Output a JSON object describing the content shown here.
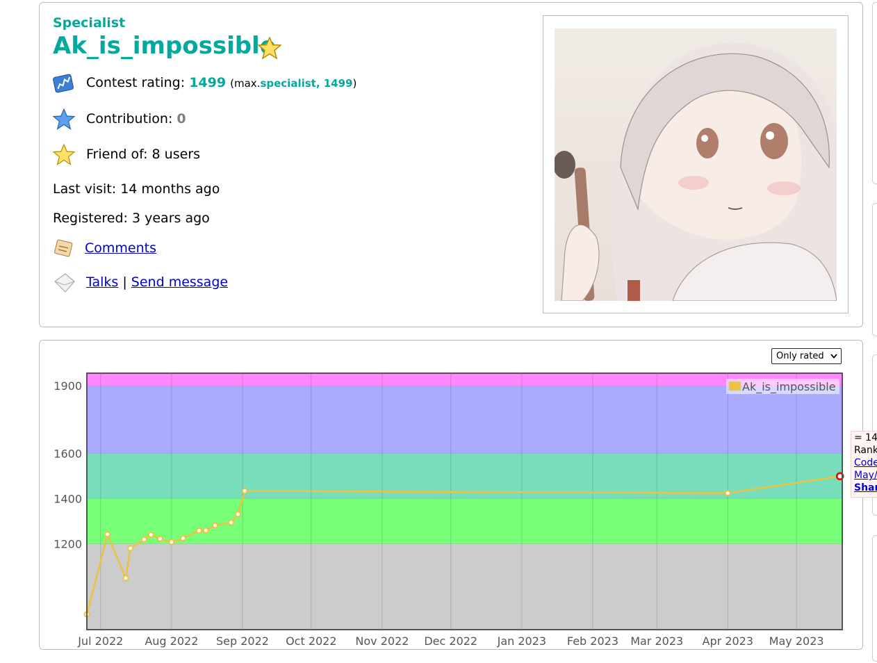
{
  "profile": {
    "rank": "Specialist",
    "handle": "Ak_is_impossible",
    "rating_label": "Contest rating:",
    "rating_value": "1499",
    "max_prefix": "(max.",
    "max_rank_rating": "specialist, 1499",
    "max_suffix": ")",
    "contribution_label": "Contribution:",
    "contribution_value": "0",
    "friend_label": "Friend of: 8 users",
    "last_visit": "Last visit: 14 months ago",
    "registered": "Registered: 3 years ago",
    "comments_link": "Comments",
    "talks_link": "Talks",
    "separator": "|",
    "send_message_link": "Send message"
  },
  "filter": {
    "selected": "Only rated"
  },
  "tooltip": {
    "line1": "= 14",
    "line2": "Rank",
    "line3": "Code",
    "line4": "May/",
    "line5": "Shar"
  },
  "colors": {
    "specialist": "#03a89e",
    "band_gray": "#cccccc",
    "band_green": "#77ff77",
    "band_cyan": "#77ddbb",
    "band_blue": "#aaaaff",
    "band_violet": "#ff88ff",
    "series": "#edc240"
  },
  "chart_data": {
    "type": "line",
    "legend": "Ak_is_impossible",
    "legend_position": "top-right",
    "ylim": [
      820,
      1955
    ],
    "y_ticks": [
      "1200",
      "1400",
      "1600",
      "1900"
    ],
    "y_tick_values": [
      1200,
      1400,
      1600,
      1900
    ],
    "x_ticks": [
      "Jul 2022",
      "Aug 2022",
      "Sep 2022",
      "Oct 2022",
      "Nov 2022",
      "Dec 2022",
      "Jan 2023",
      "Feb 2023",
      "Mar 2023",
      "Apr 2023",
      "May 2023"
    ],
    "x_tick_dates": [
      "2022-07-01",
      "2022-08-01",
      "2022-09-01",
      "2022-10-01",
      "2022-11-01",
      "2022-12-01",
      "2023-01-01",
      "2023-02-01",
      "2023-03-01",
      "2023-04-01",
      "2023-05-01"
    ],
    "xlim": [
      "2022-06-25",
      "2023-05-21"
    ],
    "rating_bands": [
      {
        "from": 0,
        "to": 1200,
        "color": "#cccccc"
      },
      {
        "from": 1200,
        "to": 1400,
        "color": "#77ff77"
      },
      {
        "from": 1400,
        "to": 1600,
        "color": "#77ddbb"
      },
      {
        "from": 1600,
        "to": 1900,
        "color": "#aaaaff"
      },
      {
        "from": 1900,
        "to": 2100,
        "color": "#ff88ff"
      }
    ],
    "series": [
      {
        "name": "Ak_is_impossible",
        "points": [
          {
            "x": "2022-06-25",
            "y": 888
          },
          {
            "x": "2022-07-04",
            "y": 1242
          },
          {
            "x": "2022-07-12",
            "y": 1048
          },
          {
            "x": "2022-07-14",
            "y": 1180
          },
          {
            "x": "2022-07-20",
            "y": 1219
          },
          {
            "x": "2022-07-23",
            "y": 1240
          },
          {
            "x": "2022-07-27",
            "y": 1222
          },
          {
            "x": "2022-08-01",
            "y": 1208
          },
          {
            "x": "2022-08-06",
            "y": 1224
          },
          {
            "x": "2022-08-13",
            "y": 1258
          },
          {
            "x": "2022-08-16",
            "y": 1259
          },
          {
            "x": "2022-08-20",
            "y": 1281
          },
          {
            "x": "2022-08-27",
            "y": 1294
          },
          {
            "x": "2022-08-30",
            "y": 1331
          },
          {
            "x": "2022-09-02",
            "y": 1434
          },
          {
            "x": "2023-04-01",
            "y": 1424
          },
          {
            "x": "2023-05-20",
            "y": 1499
          }
        ]
      }
    ]
  }
}
